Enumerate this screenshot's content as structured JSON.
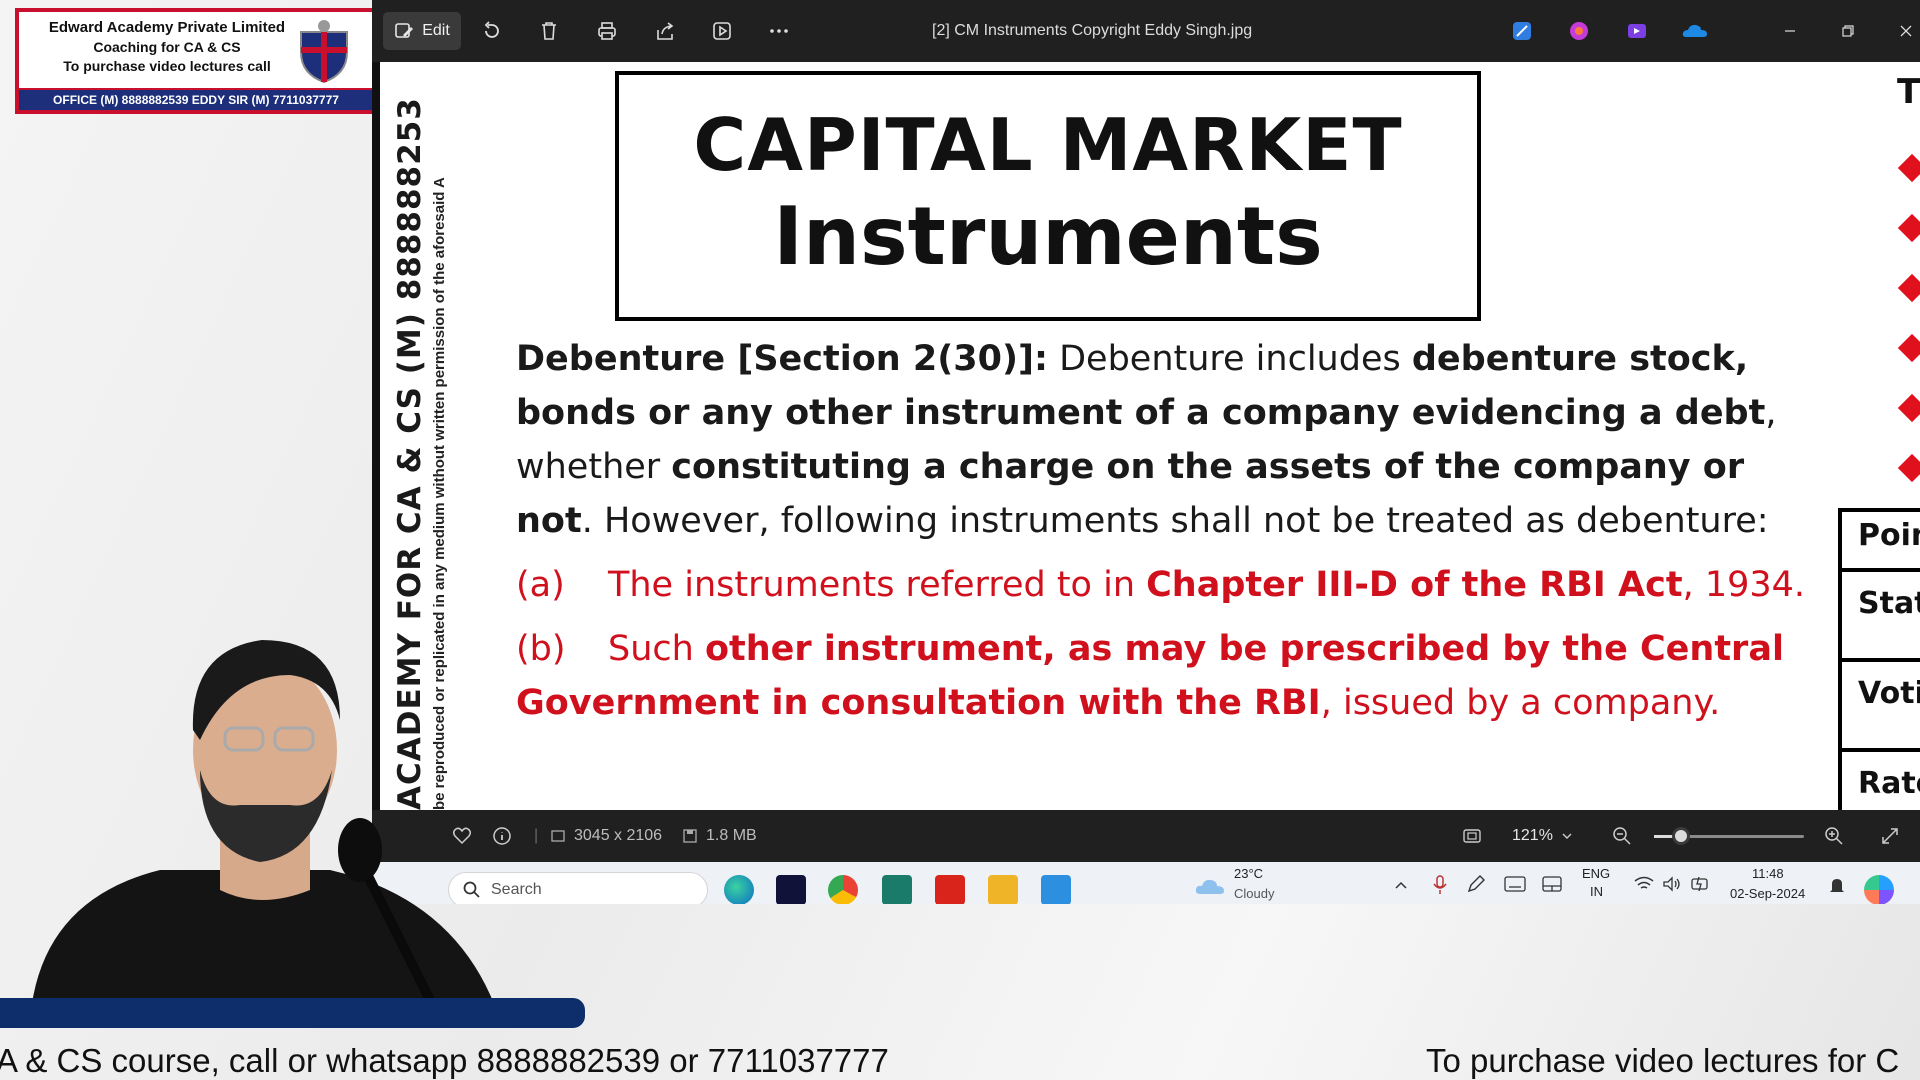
{
  "brand": {
    "line1": "Edward Academy Private Limited",
    "line2": "Coaching for CA & CS",
    "line3": "To purchase video lectures call",
    "contact_bar": "OFFICE (M) 8888882539 EDDY SIR (M) 7711037777"
  },
  "window": {
    "title": "[2] CM Instruments Copyright Eddy Singh.jpg",
    "edit_label": "Edit"
  },
  "document": {
    "vertical_big": "ACADEMY FOR CA & CS (M) 888888253",
    "vertical_small": "be reproduced or replicated in any medium without written permission of the aforesaid A",
    "title_line1": "CAPITAL MARKET",
    "title_line2": "Instruments",
    "para": {
      "b1": "Debenture [Section 2(30)]:",
      "t1": " Debenture includes ",
      "b2": "debenture stock, bonds or any other instrument of a company evidencing a debt",
      "t2": ", whether ",
      "b3": "constituting a charge on the assets of the company or not",
      "t3": ". However, following instruments shall not be treated as debenture:"
    },
    "item_a": {
      "marker": "(a)",
      "t1": "The instruments referred to in ",
      "b1": "Chapter III-D of the RBI Act",
      "t2": ", 1934."
    },
    "item_b": {
      "marker": "(b)",
      "t1": "Such ",
      "b1": "other instrument, as may be prescribed by the Central Government in consultation with the RBI",
      "t2": ", issued by a company."
    },
    "right_cells": [
      "Poin",
      "Stat",
      "Voti",
      "Rate"
    ],
    "right_top": "T"
  },
  "infobar": {
    "dimensions": "3045 x 2106",
    "file_size": "1.8 MB",
    "zoom": "121%",
    "zoom_fraction": 0.18
  },
  "taskbar": {
    "search_placeholder": "Search",
    "weather_temp": "23°C",
    "weather_desc": "Cloudy",
    "lang1": "ENG",
    "lang2": "IN",
    "time": "11:48",
    "date": "02-Sep-2024"
  },
  "ticker": {
    "left": "A & CS course, call or whatsapp 8888882539 or 7711037777",
    "right": "To purchase video lectures for C"
  },
  "colors": {
    "accent_red": "#d0101c",
    "brand_navy": "#1d2f7a",
    "titlebar": "#202020"
  }
}
